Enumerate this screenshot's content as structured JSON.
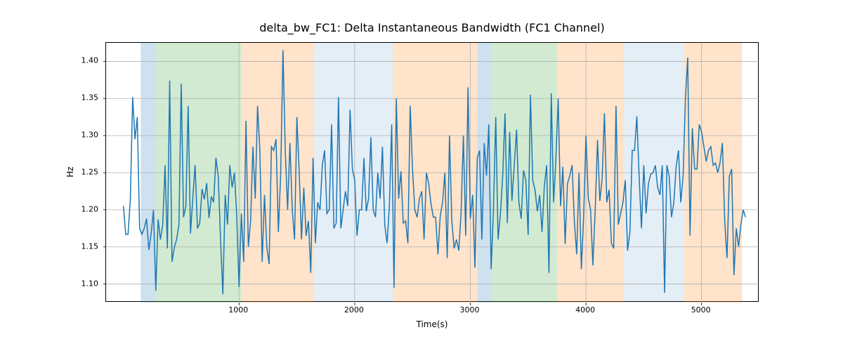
{
  "chart_data": {
    "type": "line",
    "title": "delta_bw_FC1: Delta Instantaneous Bandwidth (FC1 Channel)",
    "xlabel": "Time(s)",
    "ylabel": "Hz",
    "xlim": [
      -150,
      5500
    ],
    "ylim": [
      1.075,
      1.425
    ],
    "xticks": [
      1000,
      2000,
      3000,
      4000,
      5000
    ],
    "yticks": [
      1.1,
      1.15,
      1.2,
      1.25,
      1.3,
      1.35,
      1.4
    ],
    "grid": true,
    "background_spans": [
      {
        "x0": 150,
        "x1": 280,
        "color": "#1f77b4",
        "alpha": 0.22
      },
      {
        "x0": 280,
        "x1": 1020,
        "color": "#2ca02c",
        "alpha": 0.22
      },
      {
        "x0": 1020,
        "x1": 1650,
        "color": "#ff7f0e",
        "alpha": 0.22
      },
      {
        "x0": 1650,
        "x1": 2330,
        "color": "#1f77b4",
        "alpha": 0.12
      },
      {
        "x0": 2330,
        "x1": 3060,
        "color": "#ff7f0e",
        "alpha": 0.22
      },
      {
        "x0": 3060,
        "x1": 3180,
        "color": "#1f77b4",
        "alpha": 0.22
      },
      {
        "x0": 3180,
        "x1": 3750,
        "color": "#2ca02c",
        "alpha": 0.22
      },
      {
        "x0": 3750,
        "x1": 4330,
        "color": "#ff7f0e",
        "alpha": 0.22
      },
      {
        "x0": 4330,
        "x1": 4850,
        "color": "#1f77b4",
        "alpha": 0.12
      },
      {
        "x0": 4850,
        "x1": 5350,
        "color": "#ff7f0e",
        "alpha": 0.22
      }
    ],
    "series": [
      {
        "name": "delta_bw_FC1",
        "x_start": 0,
        "x_step": 20,
        "values": [
          1.205,
          1.167,
          1.167,
          1.215,
          1.352,
          1.295,
          1.325,
          1.175,
          1.167,
          1.175,
          1.188,
          1.146,
          1.168,
          1.2,
          1.091,
          1.187,
          1.16,
          1.18,
          1.26,
          1.148,
          1.374,
          1.13,
          1.149,
          1.16,
          1.18,
          1.37,
          1.19,
          1.205,
          1.34,
          1.168,
          1.216,
          1.26,
          1.175,
          1.182,
          1.228,
          1.214,
          1.236,
          1.189,
          1.218,
          1.21,
          1.27,
          1.245,
          1.16,
          1.086,
          1.22,
          1.18,
          1.26,
          1.23,
          1.25,
          1.191,
          1.096,
          1.195,
          1.13,
          1.32,
          1.15,
          1.185,
          1.285,
          1.215,
          1.34,
          1.28,
          1.13,
          1.22,
          1.15,
          1.127,
          1.285,
          1.28,
          1.295,
          1.17,
          1.248,
          1.415,
          1.278,
          1.2,
          1.29,
          1.2,
          1.16,
          1.325,
          1.252,
          1.16,
          1.23,
          1.165,
          1.185,
          1.115,
          1.27,
          1.155,
          1.21,
          1.2,
          1.26,
          1.28,
          1.195,
          1.2,
          1.315,
          1.175,
          1.182,
          1.352,
          1.175,
          1.2,
          1.225,
          1.205,
          1.335,
          1.255,
          1.24,
          1.165,
          1.2,
          1.2,
          1.27,
          1.198,
          1.215,
          1.298,
          1.2,
          1.19,
          1.25,
          1.215,
          1.285,
          1.18,
          1.155,
          1.205,
          1.315,
          1.095,
          1.35,
          1.215,
          1.252,
          1.182,
          1.185,
          1.155,
          1.34,
          1.255,
          1.2,
          1.19,
          1.215,
          1.225,
          1.16,
          1.25,
          1.235,
          1.208,
          1.19,
          1.19,
          1.14,
          1.192,
          1.21,
          1.25,
          1.135,
          1.3,
          1.185,
          1.148,
          1.16,
          1.145,
          1.196,
          1.3,
          1.165,
          1.365,
          1.188,
          1.22,
          1.122,
          1.27,
          1.28,
          1.16,
          1.29,
          1.246,
          1.315,
          1.12,
          1.2,
          1.325,
          1.16,
          1.194,
          1.245,
          1.33,
          1.182,
          1.305,
          1.212,
          1.26,
          1.308,
          1.21,
          1.188,
          1.253,
          1.24,
          1.166,
          1.355,
          1.24,
          1.226,
          1.198,
          1.22,
          1.17,
          1.232,
          1.26,
          1.115,
          1.357,
          1.21,
          1.268,
          1.35,
          1.205,
          1.258,
          1.154,
          1.235,
          1.246,
          1.26,
          1.184,
          1.14,
          1.25,
          1.12,
          1.19,
          1.3,
          1.216,
          1.2,
          1.125,
          1.2,
          1.294,
          1.212,
          1.242,
          1.33,
          1.21,
          1.227,
          1.155,
          1.148,
          1.34,
          1.18,
          1.195,
          1.21,
          1.24,
          1.145,
          1.17,
          1.28,
          1.28,
          1.326,
          1.245,
          1.175,
          1.26,
          1.195,
          1.235,
          1.248,
          1.25,
          1.26,
          1.23,
          1.22,
          1.26,
          1.088,
          1.26,
          1.245,
          1.19,
          1.21,
          1.258,
          1.28,
          1.21,
          1.245,
          1.35,
          1.405,
          1.165,
          1.31,
          1.255,
          1.255,
          1.315,
          1.305,
          1.285,
          1.265,
          1.28,
          1.285,
          1.26,
          1.263,
          1.25,
          1.264,
          1.29,
          1.185,
          1.135,
          1.245,
          1.255,
          1.112,
          1.175,
          1.15,
          1.18,
          1.2,
          1.19
        ]
      }
    ]
  }
}
